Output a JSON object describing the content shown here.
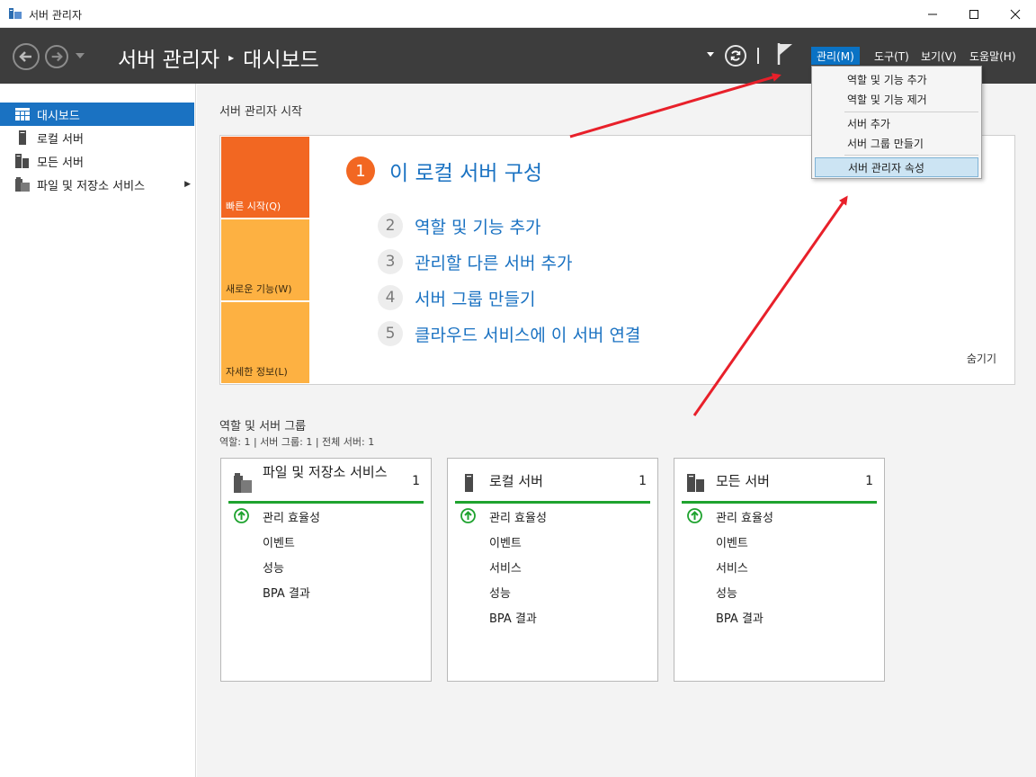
{
  "window": {
    "title": "서버 관리자",
    "minimize_icon": "minimize-icon",
    "maximize_icon": "maximize-icon",
    "close_icon": "close-icon"
  },
  "header": {
    "breadcrumb_app": "서버 관리자",
    "breadcrumb_page": "대시보드",
    "menus": [
      {
        "label": "관리(M)",
        "active": true
      },
      {
        "label": "도구(T)",
        "active": false
      },
      {
        "label": "보기(V)",
        "active": false
      },
      {
        "label": "도움말(H)",
        "active": false
      }
    ]
  },
  "manage_menu": {
    "items": [
      {
        "label": "역할 및 기능 추가",
        "highlighted": false
      },
      {
        "label": "역할 및 기능 제거",
        "highlighted": false
      },
      {
        "label": "서버 추가",
        "highlighted": false
      },
      {
        "label": "서버 그룹 만들기",
        "highlighted": false
      },
      {
        "label": "서버 관리자 속성",
        "highlighted": true
      }
    ]
  },
  "sidebar": {
    "items": [
      {
        "label": "대시보드",
        "icon": "dashboard-icon",
        "active": true
      },
      {
        "label": "로컬 서버",
        "icon": "server-icon",
        "active": false
      },
      {
        "label": "모든 서버",
        "icon": "servers-icon",
        "active": false
      },
      {
        "label": "파일 및 저장소 서비스",
        "icon": "file-storage-icon",
        "active": false,
        "expandable": true
      }
    ]
  },
  "quick_start": {
    "section_title": "서버 관리자 시작",
    "tiles": [
      {
        "label": "빠른 시작(Q)"
      },
      {
        "label": "새로운 기능(W)"
      },
      {
        "label": "자세한 정보(L)"
      }
    ],
    "main_step": {
      "number": "1",
      "label": "이 로컬 서버 구성"
    },
    "steps": [
      {
        "number": "2",
        "label": "역할 및 기능 추가"
      },
      {
        "number": "3",
        "label": "관리할 다른 서버 추가"
      },
      {
        "number": "4",
        "label": "서버 그룹 만들기"
      },
      {
        "number": "5",
        "label": "클라우드 서비스에 이 서버 연결"
      }
    ],
    "hide_label": "숨기기"
  },
  "roles": {
    "section_title": "역할 및 서버 그룹",
    "summary": "역할: 1   |   서버 그룹: 1   |   전체 서버: 1",
    "cards": [
      {
        "title": "파일 및 저장소 서비스",
        "count": "1",
        "rows": [
          "관리 효율성",
          "이벤트",
          "성능",
          "BPA 결과"
        ]
      },
      {
        "title": "로컬 서버",
        "count": "1",
        "rows": [
          "관리 효율성",
          "이벤트",
          "서비스",
          "성능",
          "BPA 결과"
        ]
      },
      {
        "title": "모든 서버",
        "count": "1",
        "rows": [
          "관리 효율성",
          "이벤트",
          "서비스",
          "성능",
          "BPA 결과"
        ]
      }
    ]
  },
  "colors": {
    "header_bg": "#3d3d3d",
    "accent_blue": "#1a72c2",
    "tile_orange": "#f26722",
    "tile_yellow": "#fdb142",
    "status_green": "#1fa32f",
    "annotation_red": "#e8202a"
  }
}
